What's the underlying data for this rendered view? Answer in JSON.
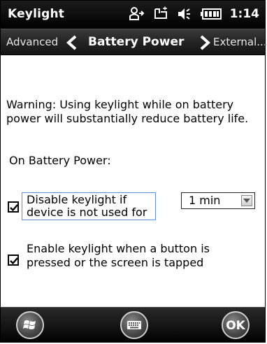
{
  "title_bar": {
    "app_title": "Keylight",
    "time": "1:14",
    "icons": [
      "sync-icon",
      "connection-icon",
      "speaker-icon",
      "battery-icon"
    ]
  },
  "nav": {
    "prev_label": "Advanced",
    "current_label": "Battery Power",
    "next_label": "External..."
  },
  "content": {
    "warning_text": "Warning: Using keylight while on battery power will substantially reduce battery life.",
    "battery_label": "On Battery Power:",
    "option1": {
      "label": "Disable keylight if device is not used for",
      "checked": true
    },
    "timeout_dropdown": {
      "value": "1 min"
    },
    "option2": {
      "label": "Enable keylight when a button is pressed or the screen is tapped",
      "checked": true
    }
  },
  "softkeys": {
    "start_icon": "windows-logo-icon",
    "keyboard_icon": "keyboard-icon",
    "ok_label": "OK"
  },
  "colors": {
    "bar_background": "#000000",
    "focus_border": "#5b8fd1",
    "content_background": "#ffffff"
  }
}
